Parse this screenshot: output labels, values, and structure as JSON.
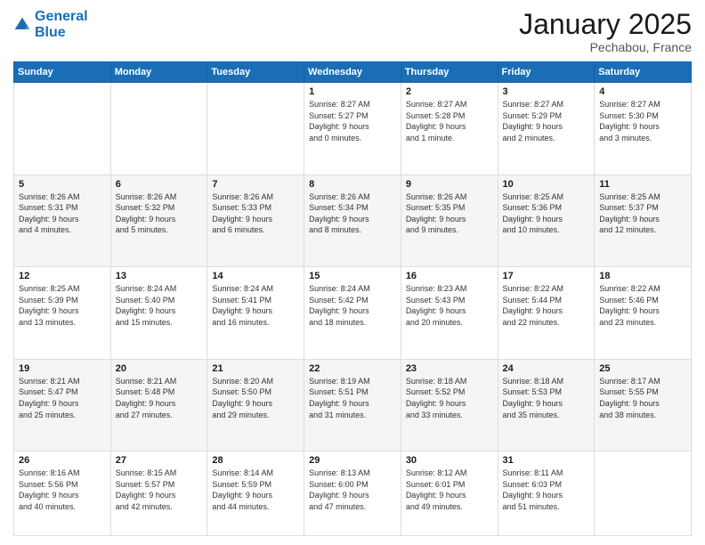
{
  "header": {
    "logo_line1": "General",
    "logo_line2": "Blue",
    "month": "January 2025",
    "location": "Pechabou, France"
  },
  "days_of_week": [
    "Sunday",
    "Monday",
    "Tuesday",
    "Wednesday",
    "Thursday",
    "Friday",
    "Saturday"
  ],
  "weeks": [
    [
      {
        "num": "",
        "info": ""
      },
      {
        "num": "",
        "info": ""
      },
      {
        "num": "",
        "info": ""
      },
      {
        "num": "1",
        "info": "Sunrise: 8:27 AM\nSunset: 5:27 PM\nDaylight: 9 hours\nand 0 minutes."
      },
      {
        "num": "2",
        "info": "Sunrise: 8:27 AM\nSunset: 5:28 PM\nDaylight: 9 hours\nand 1 minute."
      },
      {
        "num": "3",
        "info": "Sunrise: 8:27 AM\nSunset: 5:29 PM\nDaylight: 9 hours\nand 2 minutes."
      },
      {
        "num": "4",
        "info": "Sunrise: 8:27 AM\nSunset: 5:30 PM\nDaylight: 9 hours\nand 3 minutes."
      }
    ],
    [
      {
        "num": "5",
        "info": "Sunrise: 8:26 AM\nSunset: 5:31 PM\nDaylight: 9 hours\nand 4 minutes."
      },
      {
        "num": "6",
        "info": "Sunrise: 8:26 AM\nSunset: 5:32 PM\nDaylight: 9 hours\nand 5 minutes."
      },
      {
        "num": "7",
        "info": "Sunrise: 8:26 AM\nSunset: 5:33 PM\nDaylight: 9 hours\nand 6 minutes."
      },
      {
        "num": "8",
        "info": "Sunrise: 8:26 AM\nSunset: 5:34 PM\nDaylight: 9 hours\nand 8 minutes."
      },
      {
        "num": "9",
        "info": "Sunrise: 8:26 AM\nSunset: 5:35 PM\nDaylight: 9 hours\nand 9 minutes."
      },
      {
        "num": "10",
        "info": "Sunrise: 8:25 AM\nSunset: 5:36 PM\nDaylight: 9 hours\nand 10 minutes."
      },
      {
        "num": "11",
        "info": "Sunrise: 8:25 AM\nSunset: 5:37 PM\nDaylight: 9 hours\nand 12 minutes."
      }
    ],
    [
      {
        "num": "12",
        "info": "Sunrise: 8:25 AM\nSunset: 5:39 PM\nDaylight: 9 hours\nand 13 minutes."
      },
      {
        "num": "13",
        "info": "Sunrise: 8:24 AM\nSunset: 5:40 PM\nDaylight: 9 hours\nand 15 minutes."
      },
      {
        "num": "14",
        "info": "Sunrise: 8:24 AM\nSunset: 5:41 PM\nDaylight: 9 hours\nand 16 minutes."
      },
      {
        "num": "15",
        "info": "Sunrise: 8:24 AM\nSunset: 5:42 PM\nDaylight: 9 hours\nand 18 minutes."
      },
      {
        "num": "16",
        "info": "Sunrise: 8:23 AM\nSunset: 5:43 PM\nDaylight: 9 hours\nand 20 minutes."
      },
      {
        "num": "17",
        "info": "Sunrise: 8:22 AM\nSunset: 5:44 PM\nDaylight: 9 hours\nand 22 minutes."
      },
      {
        "num": "18",
        "info": "Sunrise: 8:22 AM\nSunset: 5:46 PM\nDaylight: 9 hours\nand 23 minutes."
      }
    ],
    [
      {
        "num": "19",
        "info": "Sunrise: 8:21 AM\nSunset: 5:47 PM\nDaylight: 9 hours\nand 25 minutes."
      },
      {
        "num": "20",
        "info": "Sunrise: 8:21 AM\nSunset: 5:48 PM\nDaylight: 9 hours\nand 27 minutes."
      },
      {
        "num": "21",
        "info": "Sunrise: 8:20 AM\nSunset: 5:50 PM\nDaylight: 9 hours\nand 29 minutes."
      },
      {
        "num": "22",
        "info": "Sunrise: 8:19 AM\nSunset: 5:51 PM\nDaylight: 9 hours\nand 31 minutes."
      },
      {
        "num": "23",
        "info": "Sunrise: 8:18 AM\nSunset: 5:52 PM\nDaylight: 9 hours\nand 33 minutes."
      },
      {
        "num": "24",
        "info": "Sunrise: 8:18 AM\nSunset: 5:53 PM\nDaylight: 9 hours\nand 35 minutes."
      },
      {
        "num": "25",
        "info": "Sunrise: 8:17 AM\nSunset: 5:55 PM\nDaylight: 9 hours\nand 38 minutes."
      }
    ],
    [
      {
        "num": "26",
        "info": "Sunrise: 8:16 AM\nSunset: 5:56 PM\nDaylight: 9 hours\nand 40 minutes."
      },
      {
        "num": "27",
        "info": "Sunrise: 8:15 AM\nSunset: 5:57 PM\nDaylight: 9 hours\nand 42 minutes."
      },
      {
        "num": "28",
        "info": "Sunrise: 8:14 AM\nSunset: 5:59 PM\nDaylight: 9 hours\nand 44 minutes."
      },
      {
        "num": "29",
        "info": "Sunrise: 8:13 AM\nSunset: 6:00 PM\nDaylight: 9 hours\nand 47 minutes."
      },
      {
        "num": "30",
        "info": "Sunrise: 8:12 AM\nSunset: 6:01 PM\nDaylight: 9 hours\nand 49 minutes."
      },
      {
        "num": "31",
        "info": "Sunrise: 8:11 AM\nSunset: 6:03 PM\nDaylight: 9 hours\nand 51 minutes."
      },
      {
        "num": "",
        "info": ""
      }
    ]
  ]
}
